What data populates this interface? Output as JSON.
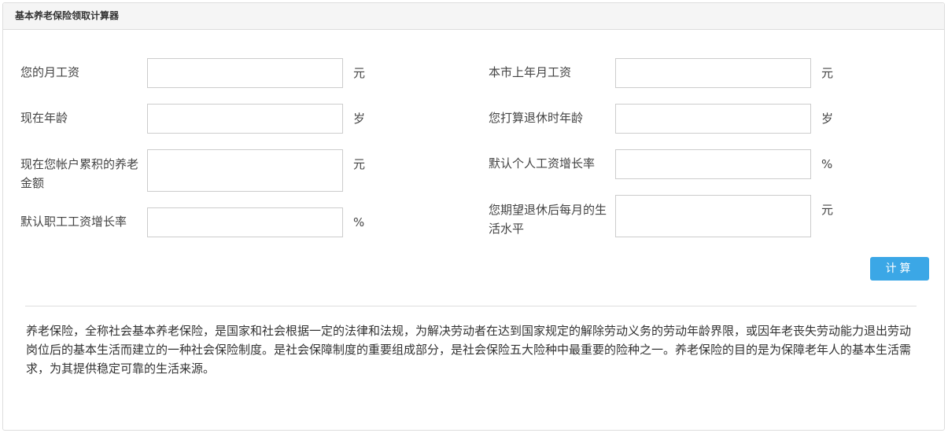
{
  "panel": {
    "title": "基本养老保险领取计算器"
  },
  "form": {
    "monthly_salary": {
      "label": "您的月工资",
      "value": "",
      "unit": "元"
    },
    "current_age": {
      "label": "现在年龄",
      "value": "",
      "unit": "岁"
    },
    "account_balance": {
      "label": "现在您帐户累积的养老金额",
      "value": "",
      "unit": "元"
    },
    "employee_wage_growth": {
      "label": "默认职工工资增长率",
      "value": "",
      "unit": "%"
    },
    "city_avg_salary": {
      "label": "本市上年月工资",
      "value": "",
      "unit": "元"
    },
    "retire_age": {
      "label": "您打算退休时年龄",
      "value": "",
      "unit": "岁"
    },
    "personal_wage_growth": {
      "label": "默认个人工资增长率",
      "value": "",
      "unit": "%"
    },
    "expected_living": {
      "label": "您期望退休后每月的生活水平",
      "value": "",
      "unit": "元"
    }
  },
  "actions": {
    "calculate_label": "计算"
  },
  "description": "养老保险，全称社会基本养老保险，是国家和社会根据一定的法律和法规，为解决劳动者在达到国家规定的解除劳动义务的劳动年龄界限，或因年老丧失劳动能力退出劳动岗位后的基本生活而建立的一种社会保险制度。是社会保障制度的重要组成部分，是社会保险五大险种中最重要的险种之一。养老保险的目的是为保障老年人的基本生活需求，为其提供稳定可靠的生活来源。"
}
